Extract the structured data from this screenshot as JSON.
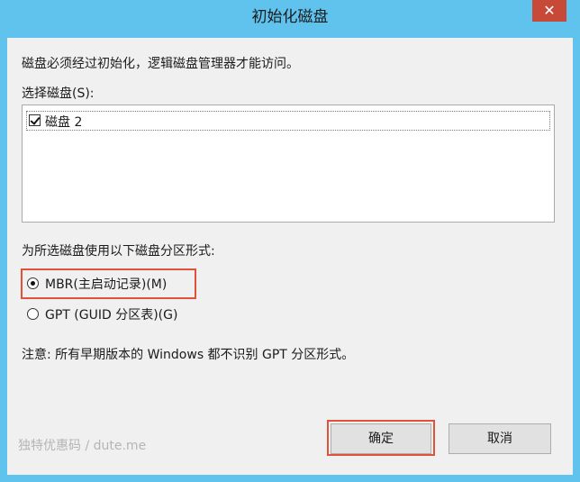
{
  "dialog": {
    "title": "初始化磁盘",
    "close_glyph": "✕",
    "description": "磁盘必须经过初始化，逻辑磁盘管理器才能访问。",
    "select_label": "选择磁盘(S):",
    "disks": [
      {
        "label": "磁盘 2",
        "checked": true
      }
    ],
    "partition_label": "为所选磁盘使用以下磁盘分区形式:",
    "options": [
      {
        "label": "MBR(主启动记录)(M)",
        "selected": true
      },
      {
        "label": "GPT (GUID 分区表)(G)",
        "selected": false
      }
    ],
    "note": "注意: 所有早期版本的 Windows 都不识别 GPT 分区形式。",
    "ok_label": "确定",
    "cancel_label": "取消",
    "watermark": "独特优惠码 / dute.me"
  },
  "colors": {
    "titlebar": "#5fc3ee",
    "close": "#c74a38",
    "highlight": "#e0533a"
  }
}
